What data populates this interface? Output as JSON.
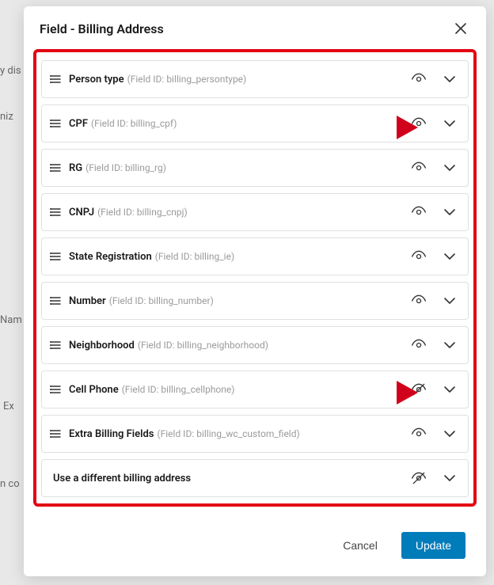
{
  "modal": {
    "title": "Field - Billing Address",
    "cancel_label": "Cancel",
    "update_label": "Update",
    "field_id_prefix": "Field ID:"
  },
  "fields": [
    {
      "name": "Person type",
      "id": "billing_persontype",
      "visible": true,
      "drag": true
    },
    {
      "name": "CPF",
      "id": "billing_cpf",
      "visible": true,
      "drag": true
    },
    {
      "name": "RG",
      "id": "billing_rg",
      "visible": true,
      "drag": true
    },
    {
      "name": "CNPJ",
      "id": "billing_cnpj",
      "visible": true,
      "drag": true
    },
    {
      "name": "State Registration",
      "id": "billing_ie",
      "visible": true,
      "drag": true
    },
    {
      "name": "Number",
      "id": "billing_number",
      "visible": true,
      "drag": true
    },
    {
      "name": "Neighborhood",
      "id": "billing_neighborhood",
      "visible": true,
      "drag": true
    },
    {
      "name": "Cell Phone",
      "id": "billing_cellphone",
      "visible": false,
      "drag": true
    },
    {
      "name": "Extra Billing Fields",
      "id": "billing_wc_custom_field",
      "visible": true,
      "drag": true
    },
    {
      "name": "Use a different billing address",
      "id": "",
      "visible": false,
      "drag": false
    }
  ],
  "bg": {
    "frag1": "y dis",
    "frag2": "niz",
    "frag3": "Nam",
    "frag4": "Ex",
    "frag5": "n co"
  }
}
